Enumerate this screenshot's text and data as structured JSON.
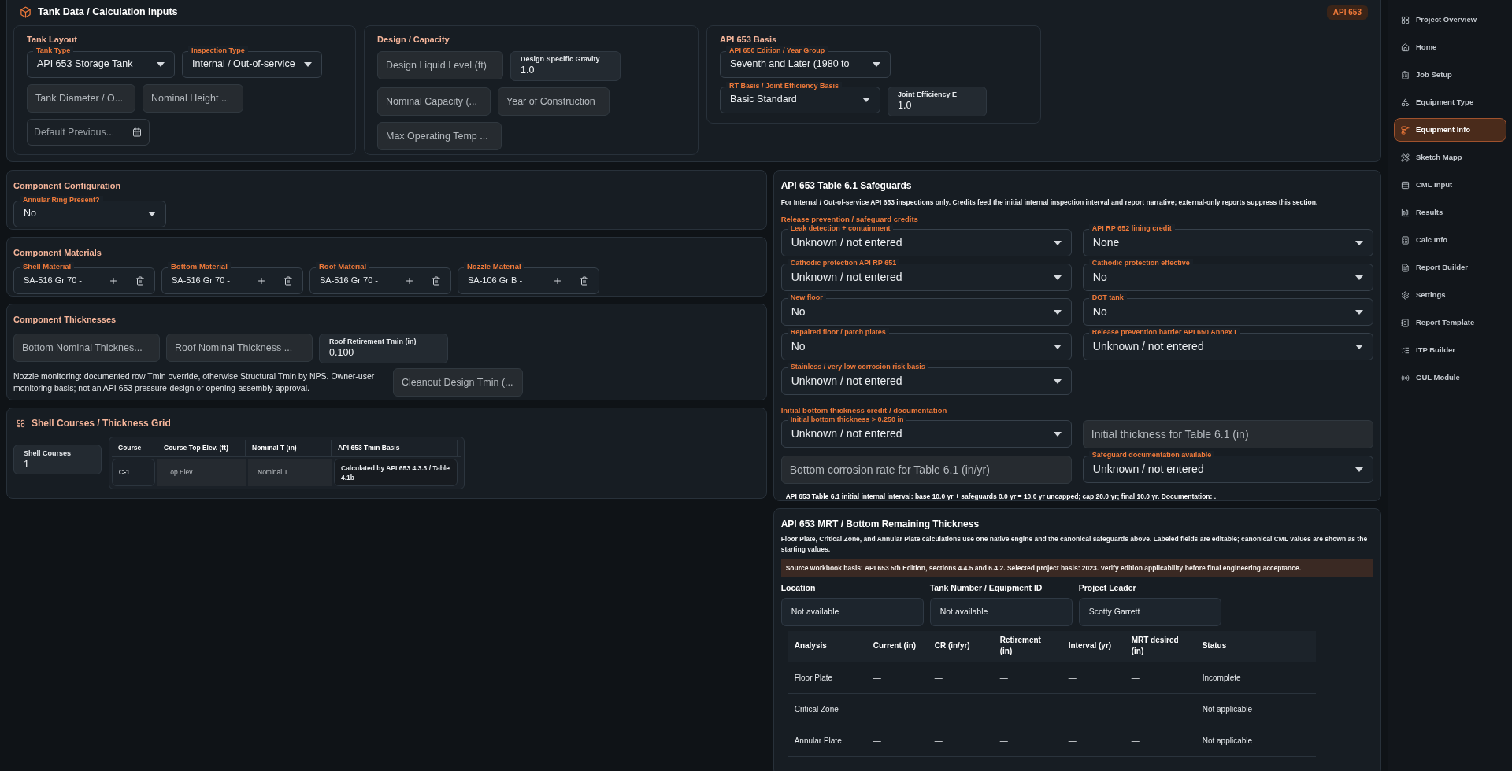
{
  "header": {
    "title": "Tank Data / Calculation Inputs",
    "badge": "API 653"
  },
  "input_groups": [
    {
      "title": "Tank Layout",
      "rows": [
        [
          {
            "kind": "select",
            "label": "Tank Type",
            "value": "API 653 Storage Tank"
          },
          {
            "kind": "select",
            "label": "Inspection Type",
            "value": "Internal / Out-of-service"
          }
        ],
        [
          {
            "kind": "placeholder",
            "placeholder": "Tank Diameter / O..."
          },
          {
            "kind": "placeholder",
            "placeholder": "Nominal Height ..."
          }
        ],
        [
          {
            "kind": "date",
            "placeholder": "Default Previous..."
          }
        ]
      ]
    },
    {
      "title": "Design / Capacity",
      "rows": [
        [
          {
            "kind": "placeholder",
            "placeholder": "Design Liquid Level (ft)"
          },
          {
            "kind": "input",
            "label": "Design Specific Gravity",
            "value": "1.0"
          }
        ],
        [
          {
            "kind": "placeholder",
            "placeholder": "Nominal Capacity (..."
          },
          {
            "kind": "placeholder",
            "placeholder": "Year of Construction"
          }
        ],
        [
          {
            "kind": "placeholder",
            "placeholder": "Max Operating Temp ..."
          }
        ]
      ]
    },
    {
      "title": "API 653 Basis",
      "rows": [
        [
          {
            "kind": "select",
            "label": "API 650 Edition / Year Group",
            "value": "Seventh and Later (1980 to"
          }
        ],
        [
          {
            "kind": "select",
            "label": "RT Basis / Joint Efficiency Basis",
            "value": "Basic Standard"
          },
          {
            "kind": "input",
            "label": "Joint Efficiency E",
            "value": "1.0"
          }
        ]
      ]
    }
  ],
  "component_configuration": {
    "title": "Component Configuration",
    "fields": [
      {
        "kind": "select",
        "label": "Annular Ring Present?",
        "value": "No"
      }
    ]
  },
  "component_materials": {
    "title": "Component Materials",
    "fields": [
      {
        "label": "Shell Material",
        "value": "SA-516 Gr 70 -"
      },
      {
        "label": "Bottom Material",
        "value": "SA-516 Gr 70 -"
      },
      {
        "label": "Roof Material",
        "value": "SA-516 Gr 70 -"
      },
      {
        "label": "Nozzle Material",
        "value": "SA-106 Gr B -"
      }
    ]
  },
  "component_thicknesses": {
    "title": "Component Thicknesses",
    "fields": [
      {
        "kind": "placeholder",
        "placeholder": "Bottom Nominal Thicknes..."
      },
      {
        "kind": "placeholder",
        "placeholder": "Roof Nominal Thickness ..."
      },
      {
        "kind": "input",
        "label": "Roof Retirement Tmin (in)",
        "value": "0.100"
      }
    ],
    "note": "Nozzle monitoring: documented row Tmin override, otherwise Structural Tmin by NPS. Owner-user monitoring basis; not an API 653 pressure-design or opening-assembly approval.",
    "extra_field": {
      "kind": "placeholder",
      "placeholder": "Cleanout Design Tmin (..."
    }
  },
  "shell_courses": {
    "title": "Shell Courses / Thickness Grid",
    "count_field": {
      "kind": "input",
      "label": "Shell Courses",
      "value": "1"
    },
    "columns": [
      "Course",
      "Course Top Elev. (ft)",
      "Nominal T (in)",
      "API 653 Tmin Basis"
    ],
    "rows": [
      {
        "course": "C-1",
        "top_elev_placeholder": "Top Elev.",
        "nominal_placeholder": "Nominal T",
        "basis": "Calculated by API 653 4.3.3 / Table 4.1b"
      }
    ]
  },
  "safeguards": {
    "title": "API 653 Table 6.1 Safeguards",
    "description": "For Internal / Out-of-service API 653 inspections only. Credits feed the initial internal inspection interval and report narrative; external-only reports suppress this section.",
    "groups": [
      {
        "heading": "Release prevention / safeguard credits",
        "fields": [
          {
            "kind": "select",
            "label": "Leak detection + containment",
            "value": "Unknown / not entered"
          },
          {
            "kind": "select",
            "label": "API RP 652 lining credit",
            "value": "None"
          },
          {
            "kind": "select",
            "label": "Cathodic protection API RP 651",
            "value": "Unknown / not entered"
          },
          {
            "kind": "select",
            "label": "Cathodic protection effective",
            "value": "No"
          },
          {
            "kind": "select",
            "label": "New floor",
            "value": "No"
          },
          {
            "kind": "select",
            "label": "DOT tank",
            "value": "No"
          },
          {
            "kind": "select",
            "label": "Repaired floor / patch plates",
            "value": "No"
          },
          {
            "kind": "select",
            "label": "Release prevention barrier API 650 Annex I",
            "value": "Unknown / not entered"
          },
          {
            "kind": "select",
            "label": "Stainless / very low corrosion risk basis",
            "value": "Unknown / not entered"
          }
        ]
      },
      {
        "heading": "Initial bottom thickness credit / documentation",
        "fields": [
          {
            "kind": "select",
            "label": "Initial bottom thickness > 0.250 in",
            "value": "Unknown / not entered"
          },
          {
            "kind": "placeholder",
            "placeholder": "Initial thickness for Table 6.1 (in)"
          },
          {
            "kind": "placeholder",
            "placeholder": "Bottom corrosion rate for Table 6.1 (in/yr)"
          },
          {
            "kind": "select",
            "label": "Safeguard documentation available",
            "value": "Unknown / not entered"
          }
        ]
      }
    ],
    "summary": "API 653 Table 6.1 initial internal interval: base 10.0 yr + safeguards 0.0 yr = 10.0 yr uncapped; cap 20.0 yr; final 10.0 yr. Documentation: ."
  },
  "mrt": {
    "title": "API 653 MRT / Bottom Remaining Thickness",
    "description": "Floor Plate, Critical Zone, and Annular Plate calculations use one native engine and the canonical safeguards above. Labeled fields are editable; canonical CML values are shown as the starting values.",
    "notice": "Source workbook basis: API 653 5th Edition, sections 4.4.5 and 6.4.2. Selected project basis: 2023. Verify edition applicability before final engineering acceptance.",
    "info_fields": [
      {
        "label": "Location",
        "value": "Not available"
      },
      {
        "label": "Tank Number / Equipment ID",
        "value": "Not available"
      },
      {
        "label": "Project Leader",
        "value": "Scotty Garrett"
      }
    ],
    "table": {
      "columns": [
        "Analysis",
        "Current (in)",
        "CR (in/yr)",
        "Retirement (in)",
        "Interval (yr)",
        "MRT desired (in)",
        "Status"
      ],
      "rows": [
        [
          "Floor Plate",
          "—",
          "—",
          "—",
          "—",
          "—",
          "Incomplete"
        ],
        [
          "Critical Zone",
          "—",
          "—",
          "—",
          "—",
          "—",
          "Not applicable"
        ],
        [
          "Annular Plate",
          "—",
          "—",
          "—",
          "—",
          "—",
          "Not applicable"
        ]
      ]
    }
  },
  "sidebar": {
    "items": [
      {
        "label": "Project Overview",
        "selected": false
      },
      {
        "label": "Home",
        "selected": false
      },
      {
        "label": "Job Setup",
        "selected": false
      },
      {
        "label": "Equipment Type",
        "selected": false
      },
      {
        "label": "Equipment Info",
        "selected": true
      },
      {
        "label": "Sketch Mapp",
        "selected": false
      },
      {
        "label": "CML Input",
        "selected": false
      },
      {
        "label": "Results",
        "selected": false
      },
      {
        "label": "Calc Info",
        "selected": false
      },
      {
        "label": "Report Builder",
        "selected": false
      },
      {
        "label": "Settings",
        "selected": false
      },
      {
        "label": "Report Template",
        "selected": false
      },
      {
        "label": "ITP Builder",
        "selected": false
      },
      {
        "label": "GUL Module",
        "selected": false
      }
    ]
  }
}
